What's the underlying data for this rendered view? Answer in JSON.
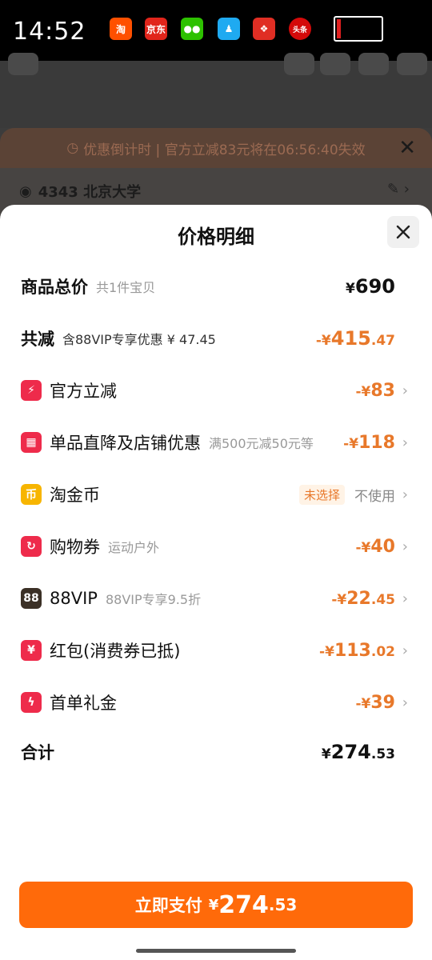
{
  "status": {
    "time": "14:52",
    "apps": [
      {
        "name": "taobao-app-icon",
        "glyph": "淘",
        "color": "#ff5000"
      },
      {
        "name": "jd-app-icon",
        "glyph": "京东",
        "color": "#e1251b"
      },
      {
        "name": "wechat-app-icon",
        "glyph": "●●",
        "color": "#2dc100"
      },
      {
        "name": "qq-app-icon",
        "glyph": "♟",
        "color": "#1faaf1"
      },
      {
        "name": "pinduoduo-app-icon",
        "glyph": "❖",
        "color": "#e02e24"
      },
      {
        "name": "toutiao-app-icon",
        "glyph": "头条",
        "color": "#d40a0a"
      }
    ]
  },
  "background": {
    "notice": "优惠倒计时 | 官方立减83元将在06:56:40失效",
    "address": "4343 北京大学"
  },
  "sheet": {
    "title": "价格明细",
    "total_goods": {
      "label": "商品总价",
      "sub": "共1件宝贝",
      "currency": "¥",
      "amount": "690"
    },
    "total_discount": {
      "label": "共减",
      "sub": "含88VIP专享优惠 ¥ 47.45",
      "prefix": "-¥",
      "int": "415",
      "dec": ".47"
    },
    "items": [
      {
        "icon": "lightning-icon",
        "icon_color": "#ee2b4b",
        "glyph": "⚡",
        "label": "官方立减",
        "sub": "",
        "prefix": "-¥",
        "int": "83",
        "dec": ""
      },
      {
        "icon": "shop-icon",
        "icon_color": "#ee2b4b",
        "glyph": "▦",
        "label": "单品直降及店铺优惠",
        "sub": "满500元减50元等",
        "prefix": "-¥",
        "int": "118",
        "dec": ""
      },
      {
        "icon": "coin-icon",
        "icon_color": "#f7b500",
        "glyph": "币",
        "label": "淘金币",
        "sub": "",
        "tag": "未选择",
        "value": "不使用"
      },
      {
        "icon": "coupon-icon",
        "icon_color": "#ee2b4b",
        "glyph": "↻",
        "label": "购物券",
        "sub": "运动户外",
        "prefix": "-¥",
        "int": "40",
        "dec": ""
      },
      {
        "icon": "vip-88-icon",
        "icon_color": "#3b3026",
        "glyph": "88",
        "label": "88VIP",
        "sub": "88VIP专享9.5折",
        "prefix": "-¥",
        "int": "22",
        "dec": ".45"
      },
      {
        "icon": "red-packet-icon",
        "icon_color": "#ee2b4b",
        "glyph": "¥",
        "label": "红包(消费券已抵)",
        "sub": "",
        "prefix": "-¥",
        "int": "113",
        "dec": ".02"
      },
      {
        "icon": "first-order-gift-icon",
        "icon_color": "#ee2b4b",
        "glyph": "ϟ",
        "label": "首单礼金",
        "sub": "",
        "prefix": "-¥",
        "int": "39",
        "dec": ""
      }
    ],
    "total": {
      "label": "合计",
      "currency": "¥",
      "int": "274",
      "dec": ".53"
    }
  },
  "pay_button": {
    "label": "立即支付",
    "currency": "¥",
    "int": "274",
    "dec": ".53"
  }
}
